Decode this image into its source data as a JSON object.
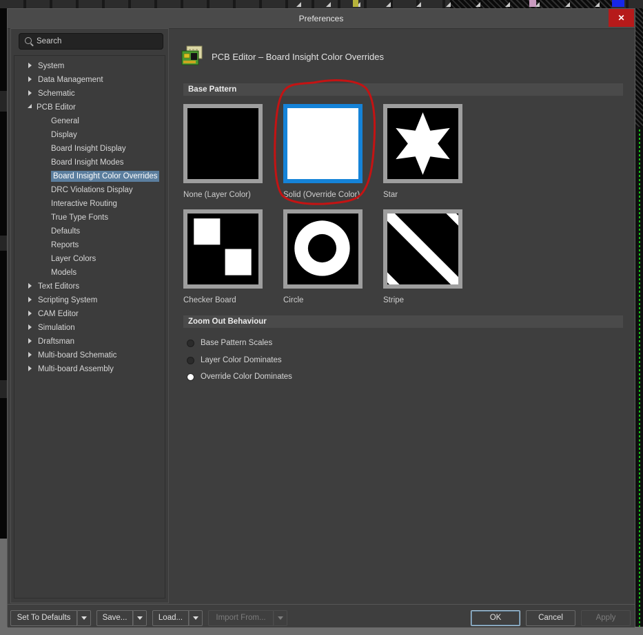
{
  "window": {
    "title": "Preferences",
    "close_glyph": "✕"
  },
  "sidebar": {
    "search_placeholder": "Search",
    "items": [
      {
        "label": "System",
        "level": 0,
        "state": "collapsed",
        "selected": false
      },
      {
        "label": "Data Management",
        "level": 0,
        "state": "collapsed",
        "selected": false
      },
      {
        "label": "Schematic",
        "level": 0,
        "state": "collapsed",
        "selected": false
      },
      {
        "label": "PCB Editor",
        "level": 0,
        "state": "expanded",
        "selected": false
      },
      {
        "label": "General",
        "level": 1,
        "state": "leaf",
        "selected": false
      },
      {
        "label": "Display",
        "level": 1,
        "state": "leaf",
        "selected": false
      },
      {
        "label": "Board Insight Display",
        "level": 1,
        "state": "leaf",
        "selected": false
      },
      {
        "label": "Board Insight Modes",
        "level": 1,
        "state": "leaf",
        "selected": false
      },
      {
        "label": "Board Insight Color Overrides",
        "level": 1,
        "state": "leaf",
        "selected": true
      },
      {
        "label": "DRC Violations Display",
        "level": 1,
        "state": "leaf",
        "selected": false
      },
      {
        "label": "Interactive Routing",
        "level": 1,
        "state": "leaf",
        "selected": false
      },
      {
        "label": "True Type Fonts",
        "level": 1,
        "state": "leaf",
        "selected": false
      },
      {
        "label": "Defaults",
        "level": 1,
        "state": "leaf",
        "selected": false
      },
      {
        "label": "Reports",
        "level": 1,
        "state": "leaf",
        "selected": false
      },
      {
        "label": "Layer Colors",
        "level": 1,
        "state": "leaf",
        "selected": false
      },
      {
        "label": "Models",
        "level": 1,
        "state": "leaf",
        "selected": false
      },
      {
        "label": "Text Editors",
        "level": 0,
        "state": "collapsed",
        "selected": false
      },
      {
        "label": "Scripting System",
        "level": 0,
        "state": "collapsed",
        "selected": false
      },
      {
        "label": "CAM Editor",
        "level": 0,
        "state": "collapsed",
        "selected": false
      },
      {
        "label": "Simulation",
        "level": 0,
        "state": "collapsed",
        "selected": false
      },
      {
        "label": "Draftsman",
        "level": 0,
        "state": "collapsed",
        "selected": false
      },
      {
        "label": "Multi-board Schematic",
        "level": 0,
        "state": "collapsed",
        "selected": false
      },
      {
        "label": "Multi-board Assembly",
        "level": 0,
        "state": "collapsed",
        "selected": false
      }
    ]
  },
  "header": {
    "title": "PCB Editor – Board Insight Color Overrides"
  },
  "base_pattern": {
    "title": "Base Pattern",
    "tiles": [
      {
        "label": "None (Layer Color)",
        "pattern": "none",
        "selected": false,
        "annotated": false
      },
      {
        "label": "Solid (Override Color)",
        "pattern": "solid",
        "selected": true,
        "annotated": true
      },
      {
        "label": "Star",
        "pattern": "star",
        "selected": false,
        "annotated": false
      },
      {
        "label": "Checker Board",
        "pattern": "checker",
        "selected": false,
        "annotated": false
      },
      {
        "label": "Circle",
        "pattern": "circle",
        "selected": false,
        "annotated": false
      },
      {
        "label": "Stripe",
        "pattern": "stripe",
        "selected": false,
        "annotated": false
      }
    ]
  },
  "zoom_out": {
    "title": "Zoom Out Behaviour",
    "options": [
      {
        "label": "Base Pattern Scales",
        "selected": false
      },
      {
        "label": "Layer Color Dominates",
        "selected": false
      },
      {
        "label": "Override Color Dominates",
        "selected": true
      }
    ]
  },
  "footer": {
    "left": [
      {
        "label": "Set To Defaults",
        "enabled": true
      },
      {
        "label": "Save...",
        "enabled": true
      },
      {
        "label": "Load...",
        "enabled": true
      },
      {
        "label": "Import From...",
        "enabled": false
      }
    ],
    "right": [
      {
        "label": "OK",
        "enabled": true,
        "focused": true
      },
      {
        "label": "Cancel",
        "enabled": true,
        "focused": false
      },
      {
        "label": "Apply",
        "enabled": false,
        "focused": false
      }
    ]
  },
  "colors": {
    "selected_tile_border": "#1583d8",
    "tree_selection": "#5b7e9e",
    "annotation_red": "#c41313",
    "close_button_red": "#b61a1a"
  }
}
